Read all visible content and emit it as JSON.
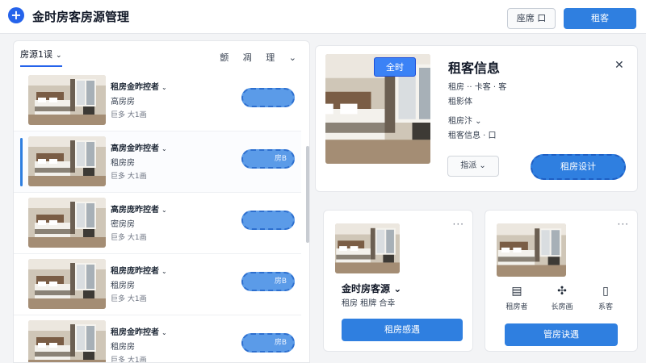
{
  "header": {
    "title": "金时房客房源管理",
    "add_icon": "plus-icon",
    "btn_outline": "座席 口",
    "btn_primary": "租客"
  },
  "left": {
    "tab": "房源1误",
    "filters": [
      "颤",
      "凋",
      "理"
    ],
    "items": [
      {
        "title": "租房金昨控者",
        "type": "高房房",
        "meta": "巨多 大1画",
        "blob": "",
        "selected": false
      },
      {
        "title": "高房金昨控者",
        "type": "租房房",
        "meta": "巨多 大1画",
        "blob": "房B",
        "selected": true
      },
      {
        "title": "高房庞昨控者",
        "type": "密房房",
        "meta": "巨多 大1画",
        "blob": "",
        "selected": false
      },
      {
        "title": "租房庞昨控者",
        "type": "租房房",
        "meta": "巨多 大1画",
        "blob": "房B",
        "selected": false
      },
      {
        "title": "租房金昨控者",
        "type": "租房房",
        "meta": "巨多 大1画",
        "blob": "房B",
        "selected": false
      }
    ]
  },
  "detail": {
    "badge": "全时",
    "title": "租客信息",
    "line1": "租房 ·· 卡客 · 客",
    "line2": "租影体",
    "line3": "租房汴",
    "line4": "租客信息 · 口",
    "btn_assign": "指派",
    "btn_design": "租房设计"
  },
  "card_a": {
    "name": "金时房客源",
    "sub": "租房 租牌 合幸",
    "btn": "租房感遇"
  },
  "card_b": {
    "features": [
      {
        "icon": "calendar-icon",
        "label": "租房者"
      },
      {
        "icon": "puzzle-icon",
        "label": "长房画"
      },
      {
        "icon": "document-icon",
        "label": "系客"
      }
    ],
    "btn": "管房诀遇"
  },
  "colors": {
    "accent": "#2f7fe0",
    "background": "#f3f4f6"
  }
}
